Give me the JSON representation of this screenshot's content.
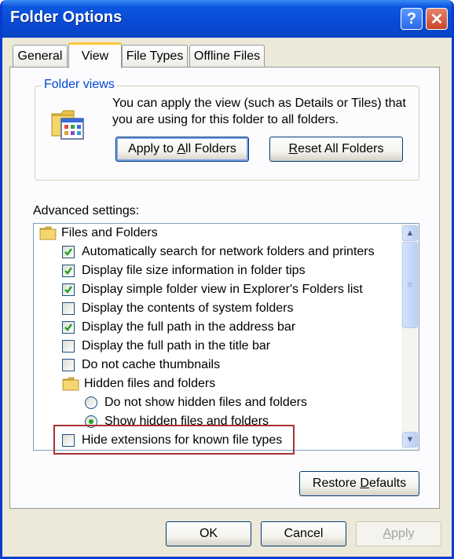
{
  "window": {
    "title": "Folder Options"
  },
  "titlebar_buttons": {
    "help": "?",
    "close": "✕"
  },
  "tabs": [
    {
      "label": "General"
    },
    {
      "label": "View"
    },
    {
      "label": "File Types"
    },
    {
      "label": "Offline Files"
    }
  ],
  "folder_views": {
    "group_title": "Folder views",
    "description": "You can apply the view (such as Details or Tiles) that you are using for this folder to all folders.",
    "apply_button": {
      "pre": "Apply to ",
      "ul": "A",
      "post": "ll Folders"
    },
    "reset_button": {
      "pre": "",
      "ul": "R",
      "post": "eset All Folders"
    }
  },
  "advanced": {
    "label": "Advanced settings:",
    "items": [
      {
        "type": "folder",
        "label": "Files and Folders",
        "level": 0
      },
      {
        "type": "checkbox",
        "label": "Automatically search for network folders and printers",
        "checked": true,
        "level": 1
      },
      {
        "type": "checkbox",
        "label": "Display file size information in folder tips",
        "checked": true,
        "level": 1
      },
      {
        "type": "checkbox",
        "label": "Display simple folder view in Explorer's Folders list",
        "checked": true,
        "level": 1
      },
      {
        "type": "checkbox",
        "label": "Display the contents of system folders",
        "checked": false,
        "level": 1
      },
      {
        "type": "checkbox",
        "label": "Display the full path in the address bar",
        "checked": true,
        "level": 1
      },
      {
        "type": "checkbox",
        "label": "Display the full path in the title bar",
        "checked": false,
        "level": 1
      },
      {
        "type": "checkbox",
        "label": "Do not cache thumbnails",
        "checked": false,
        "level": 1
      },
      {
        "type": "folder",
        "label": "Hidden files and folders",
        "level": 1
      },
      {
        "type": "radio",
        "label": "Do not show hidden files and folders",
        "checked": false,
        "level": 2
      },
      {
        "type": "radio",
        "label": "Show hidden files and folders",
        "checked": true,
        "level": 2
      },
      {
        "type": "checkbox",
        "label": "Hide extensions for known file types",
        "checked": false,
        "level": 1
      }
    ]
  },
  "restore_button": {
    "pre": "Restore ",
    "ul": "D",
    "post": "efaults"
  },
  "dialog_buttons": {
    "ok": "OK",
    "cancel": "Cancel",
    "apply": {
      "pre": "",
      "ul": "A",
      "post": "pply"
    }
  },
  "colors": {
    "accent_blue": "#0046D5",
    "highlight_box": "#A93131",
    "check_green": "#21A121"
  }
}
